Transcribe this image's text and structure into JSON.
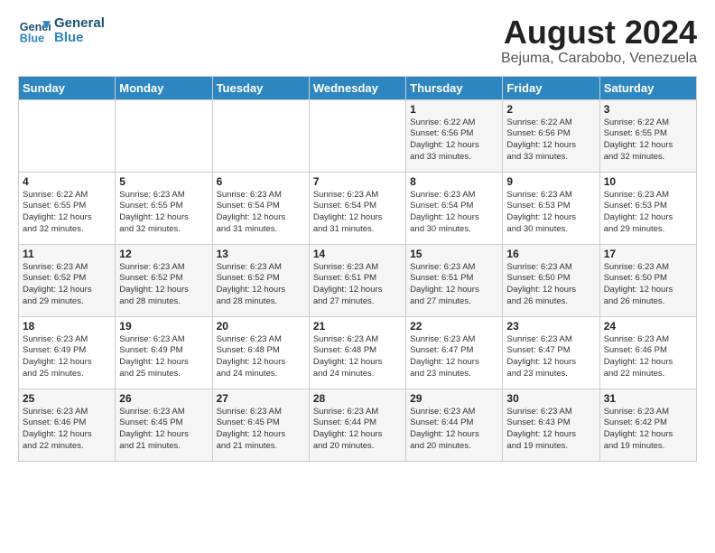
{
  "logo": {
    "line1": "General",
    "line2": "Blue"
  },
  "title": "August 2024",
  "subtitle": "Bejuma, Carabobo, Venezuela",
  "days_of_week": [
    "Sunday",
    "Monday",
    "Tuesday",
    "Wednesday",
    "Thursday",
    "Friday",
    "Saturday"
  ],
  "weeks": [
    [
      {
        "day": "",
        "info": ""
      },
      {
        "day": "",
        "info": ""
      },
      {
        "day": "",
        "info": ""
      },
      {
        "day": "",
        "info": ""
      },
      {
        "day": "1",
        "info": "Sunrise: 6:22 AM\nSunset: 6:56 PM\nDaylight: 12 hours\nand 33 minutes."
      },
      {
        "day": "2",
        "info": "Sunrise: 6:22 AM\nSunset: 6:56 PM\nDaylight: 12 hours\nand 33 minutes."
      },
      {
        "day": "3",
        "info": "Sunrise: 6:22 AM\nSunset: 6:55 PM\nDaylight: 12 hours\nand 32 minutes."
      }
    ],
    [
      {
        "day": "4",
        "info": "Sunrise: 6:22 AM\nSunset: 6:55 PM\nDaylight: 12 hours\nand 32 minutes."
      },
      {
        "day": "5",
        "info": "Sunrise: 6:23 AM\nSunset: 6:55 PM\nDaylight: 12 hours\nand 32 minutes."
      },
      {
        "day": "6",
        "info": "Sunrise: 6:23 AM\nSunset: 6:54 PM\nDaylight: 12 hours\nand 31 minutes."
      },
      {
        "day": "7",
        "info": "Sunrise: 6:23 AM\nSunset: 6:54 PM\nDaylight: 12 hours\nand 31 minutes."
      },
      {
        "day": "8",
        "info": "Sunrise: 6:23 AM\nSunset: 6:54 PM\nDaylight: 12 hours\nand 30 minutes."
      },
      {
        "day": "9",
        "info": "Sunrise: 6:23 AM\nSunset: 6:53 PM\nDaylight: 12 hours\nand 30 minutes."
      },
      {
        "day": "10",
        "info": "Sunrise: 6:23 AM\nSunset: 6:53 PM\nDaylight: 12 hours\nand 29 minutes."
      }
    ],
    [
      {
        "day": "11",
        "info": "Sunrise: 6:23 AM\nSunset: 6:52 PM\nDaylight: 12 hours\nand 29 minutes."
      },
      {
        "day": "12",
        "info": "Sunrise: 6:23 AM\nSunset: 6:52 PM\nDaylight: 12 hours\nand 28 minutes."
      },
      {
        "day": "13",
        "info": "Sunrise: 6:23 AM\nSunset: 6:52 PM\nDaylight: 12 hours\nand 28 minutes."
      },
      {
        "day": "14",
        "info": "Sunrise: 6:23 AM\nSunset: 6:51 PM\nDaylight: 12 hours\nand 27 minutes."
      },
      {
        "day": "15",
        "info": "Sunrise: 6:23 AM\nSunset: 6:51 PM\nDaylight: 12 hours\nand 27 minutes."
      },
      {
        "day": "16",
        "info": "Sunrise: 6:23 AM\nSunset: 6:50 PM\nDaylight: 12 hours\nand 26 minutes."
      },
      {
        "day": "17",
        "info": "Sunrise: 6:23 AM\nSunset: 6:50 PM\nDaylight: 12 hours\nand 26 minutes."
      }
    ],
    [
      {
        "day": "18",
        "info": "Sunrise: 6:23 AM\nSunset: 6:49 PM\nDaylight: 12 hours\nand 25 minutes."
      },
      {
        "day": "19",
        "info": "Sunrise: 6:23 AM\nSunset: 6:49 PM\nDaylight: 12 hours\nand 25 minutes."
      },
      {
        "day": "20",
        "info": "Sunrise: 6:23 AM\nSunset: 6:48 PM\nDaylight: 12 hours\nand 24 minutes."
      },
      {
        "day": "21",
        "info": "Sunrise: 6:23 AM\nSunset: 6:48 PM\nDaylight: 12 hours\nand 24 minutes."
      },
      {
        "day": "22",
        "info": "Sunrise: 6:23 AM\nSunset: 6:47 PM\nDaylight: 12 hours\nand 23 minutes."
      },
      {
        "day": "23",
        "info": "Sunrise: 6:23 AM\nSunset: 6:47 PM\nDaylight: 12 hours\nand 23 minutes."
      },
      {
        "day": "24",
        "info": "Sunrise: 6:23 AM\nSunset: 6:46 PM\nDaylight: 12 hours\nand 22 minutes."
      }
    ],
    [
      {
        "day": "25",
        "info": "Sunrise: 6:23 AM\nSunset: 6:46 PM\nDaylight: 12 hours\nand 22 minutes."
      },
      {
        "day": "26",
        "info": "Sunrise: 6:23 AM\nSunset: 6:45 PM\nDaylight: 12 hours\nand 21 minutes."
      },
      {
        "day": "27",
        "info": "Sunrise: 6:23 AM\nSunset: 6:45 PM\nDaylight: 12 hours\nand 21 minutes."
      },
      {
        "day": "28",
        "info": "Sunrise: 6:23 AM\nSunset: 6:44 PM\nDaylight: 12 hours\nand 20 minutes."
      },
      {
        "day": "29",
        "info": "Sunrise: 6:23 AM\nSunset: 6:44 PM\nDaylight: 12 hours\nand 20 minutes."
      },
      {
        "day": "30",
        "info": "Sunrise: 6:23 AM\nSunset: 6:43 PM\nDaylight: 12 hours\nand 19 minutes."
      },
      {
        "day": "31",
        "info": "Sunrise: 6:23 AM\nSunset: 6:42 PM\nDaylight: 12 hours\nand 19 minutes."
      }
    ]
  ]
}
